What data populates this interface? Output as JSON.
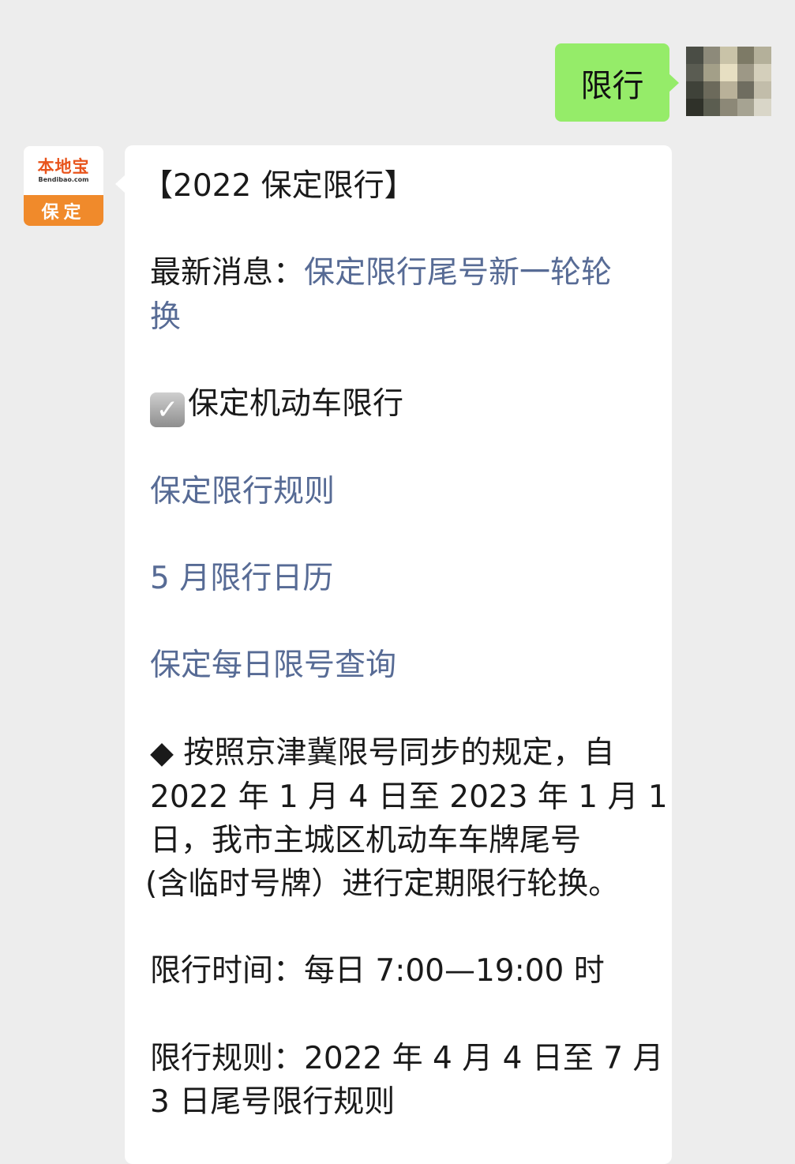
{
  "outgoing": {
    "text": "限行"
  },
  "bot_avatar": {
    "brand": "本地宝",
    "url": "Bendibao.com",
    "city": "保定"
  },
  "incoming": {
    "title": "【2022 保定限行】",
    "latest_label": "最新消息：",
    "latest_link_line1": "保定限行尾号新一轮轮",
    "latest_link_line2": "换",
    "section": "保定机动车限行",
    "link_rules": "保定限行规则",
    "link_calendar": "5 月限行日历",
    "link_daily": "保定每日限号查询",
    "para1": [
      "◆ 按照京津冀限号同步的规定，自",
      "2022 年 1 月 4 日至 2023 年 1 月 1",
      "日，我市主城区机动车车牌尾号",
      "(含临时号牌）进行定期限行轮换。"
    ],
    "time_line": "限行时间：每日 7:00—19:00 时",
    "rule_line1": "限行规则：2022 年 4 月 4 日至 7 月",
    "rule_line2": "3 日尾号限行规则"
  },
  "colors": {
    "bubble_out": "#95ec69",
    "link": "#576b95",
    "background": "#ededed"
  },
  "icons": {
    "check": "checkbox-checked-icon"
  }
}
